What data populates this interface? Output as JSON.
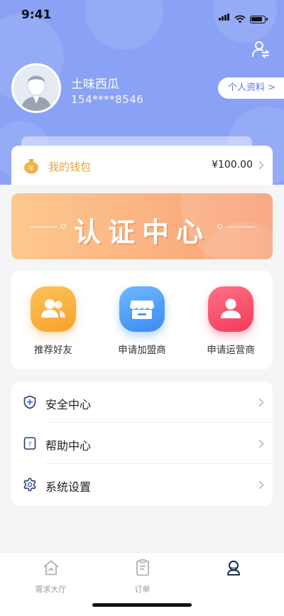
{
  "status": {
    "time": "9:41"
  },
  "profile": {
    "name": "土味西瓜",
    "phone": "154****8546",
    "profile_button": "个人资料 >"
  },
  "wallet": {
    "label": "我的钱包",
    "amount": "¥100.00",
    "icon": "wallet-coin-icon"
  },
  "banner": {
    "title": "认证中心"
  },
  "actions": [
    {
      "label": "推荐好友",
      "icon": "friends-icon",
      "color": "#fbb03b"
    },
    {
      "label": "申请加盟商",
      "icon": "store-icon",
      "color": "#4a9af8"
    },
    {
      "label": "申请运营商",
      "icon": "operator-icon",
      "color": "#f5506b"
    }
  ],
  "menu": [
    {
      "label": "安全中心",
      "icon": "shield-icon"
    },
    {
      "label": "帮助中心",
      "icon": "help-icon"
    },
    {
      "label": "系统设置",
      "icon": "gear-icon"
    }
  ],
  "tabs": [
    {
      "label": "需求大厅",
      "icon": "home-icon"
    },
    {
      "label": "订单",
      "icon": "order-icon"
    },
    {
      "label": "",
      "icon": "profile-icon"
    }
  ],
  "colors": {
    "hero": "#8aa2f5",
    "accent": "#5a78f0",
    "wallet_label": "#e9a23b"
  }
}
